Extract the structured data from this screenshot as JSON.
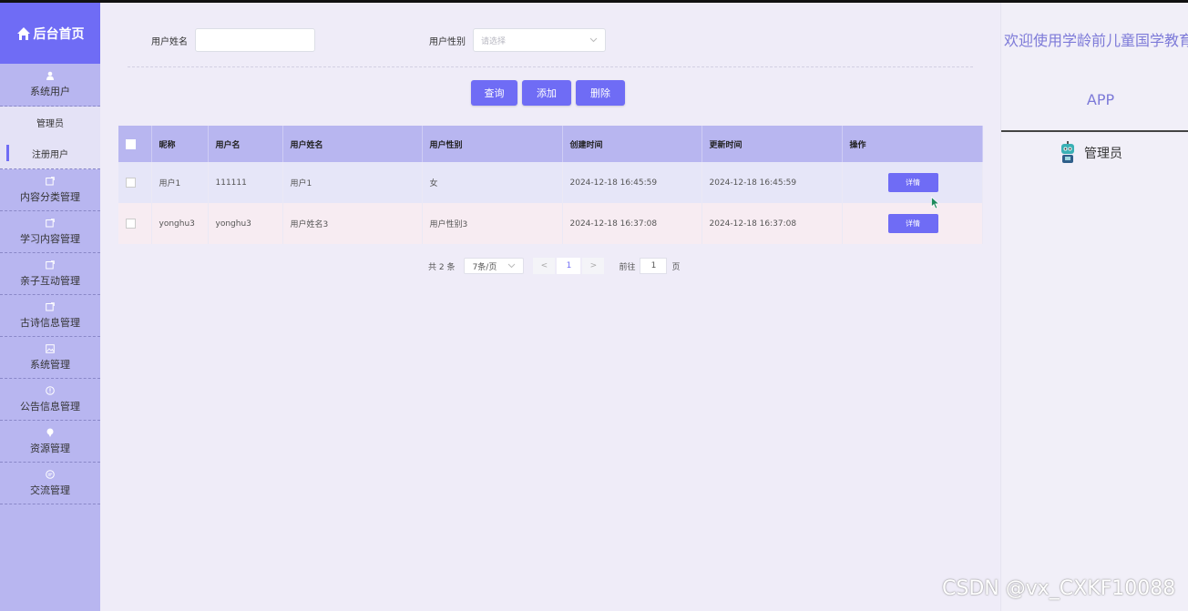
{
  "sidebar": {
    "brand": "后台首页",
    "group_system_users": {
      "label": "系统用户",
      "sub": [
        "管理员",
        "注册用户"
      ]
    },
    "items": [
      {
        "label": "内容分类管理",
        "icon": "edit-icon"
      },
      {
        "label": "学习内容管理",
        "icon": "edit-icon"
      },
      {
        "label": "亲子互动管理",
        "icon": "edit-icon"
      },
      {
        "label": "古诗信息管理",
        "icon": "edit-icon"
      },
      {
        "label": "系统管理",
        "icon": "picture-icon"
      },
      {
        "label": "公告信息管理",
        "icon": "info-icon"
      },
      {
        "label": "资源管理",
        "icon": "pin-icon"
      },
      {
        "label": "交流管理",
        "icon": "chat-icon"
      }
    ]
  },
  "search": {
    "name_label": "用户姓名",
    "name_value": "",
    "gender_label": "用户性别",
    "gender_placeholder": "请选择"
  },
  "toolbar": {
    "query": "查询",
    "add": "添加",
    "delete": "删除"
  },
  "table": {
    "headers": [
      "昵称",
      "用户名",
      "用户姓名",
      "用户性别",
      "创建时间",
      "更新时间",
      "操作"
    ],
    "rows": [
      [
        "用户1",
        "111111",
        "用户1",
        "女",
        "2024-12-18 16:45:59",
        "2024-12-18 16:45:59"
      ],
      [
        "yonghu3",
        "yonghu3",
        "用户姓名3",
        "用户性别3",
        "2024-12-18 16:37:08",
        "2024-12-18 16:37:08"
      ]
    ],
    "detail_label": "详情"
  },
  "pagination": {
    "total": "共 2 条",
    "page_size": "7条/页",
    "prev": "<",
    "current": "1",
    "next": ">",
    "goto_prefix": "前往",
    "goto_value": "1",
    "goto_suffix": "页"
  },
  "right_panel": {
    "welcome": "欢迎使用学龄前儿童国学教育",
    "app": "APP",
    "user": "管理员"
  },
  "watermark": "CSDN @vx_CXKF10088",
  "colors": {
    "accent": "#6f6cf5",
    "sidebar": "#b8b6f0",
    "background": "#efecf8"
  }
}
